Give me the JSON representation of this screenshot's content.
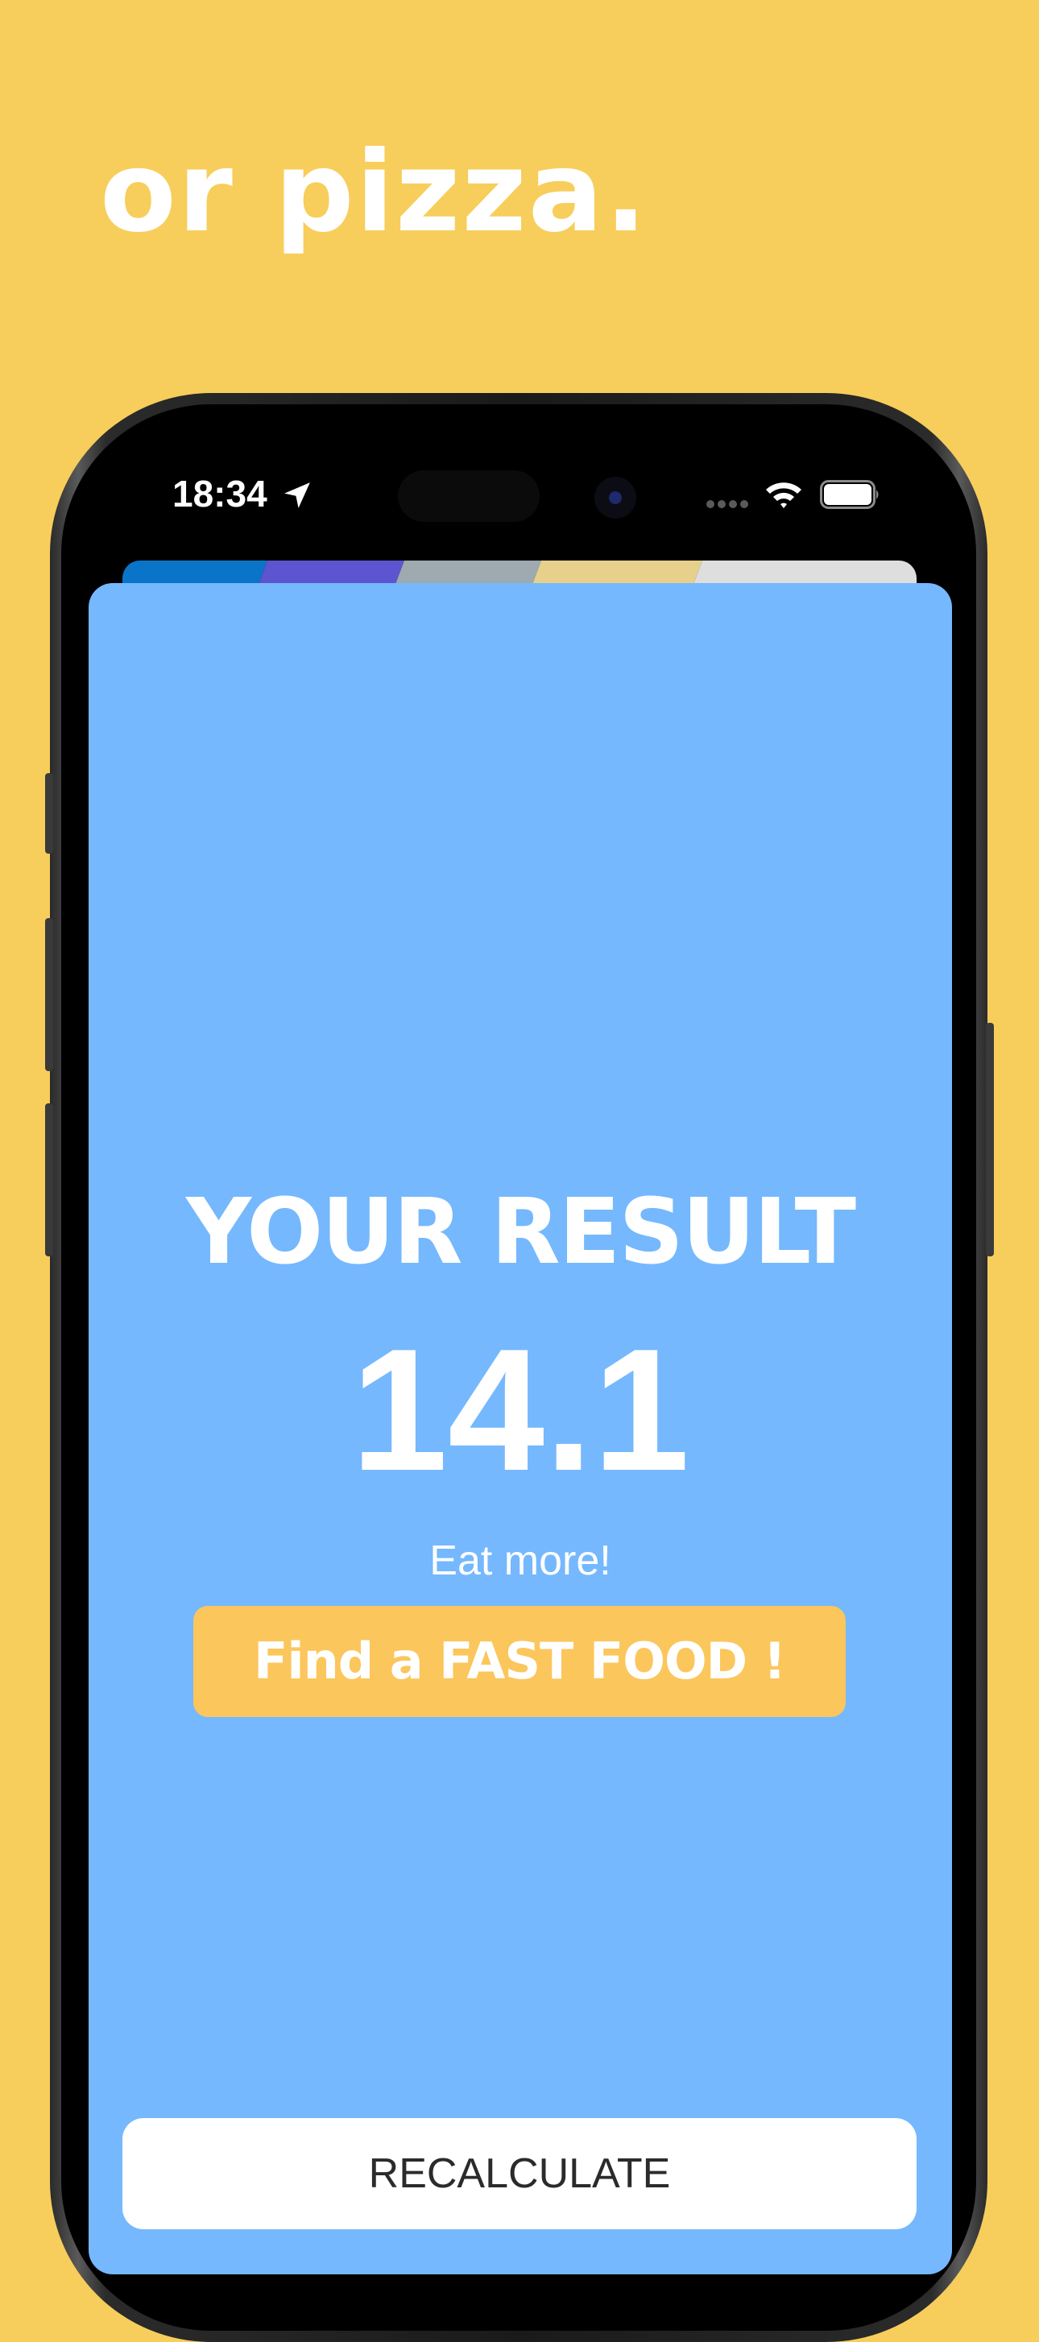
{
  "headline": "or pizza.",
  "colors": {
    "background": "#f7ce5b",
    "sheet": "#75b8fd",
    "accent_button": "#fbc65c",
    "text": "#ffffff"
  },
  "status_bar": {
    "time": "18:34",
    "icons": [
      "location-arrow-icon",
      "signal-dots-icon",
      "wifi-icon",
      "battery-icon"
    ]
  },
  "result": {
    "title": "YOUR RESULT",
    "value": "14.1",
    "advice": "Eat more!"
  },
  "buttons": {
    "find_fast_food": "Find a FAST FOOD !",
    "recalculate": "RECALCULATE"
  }
}
